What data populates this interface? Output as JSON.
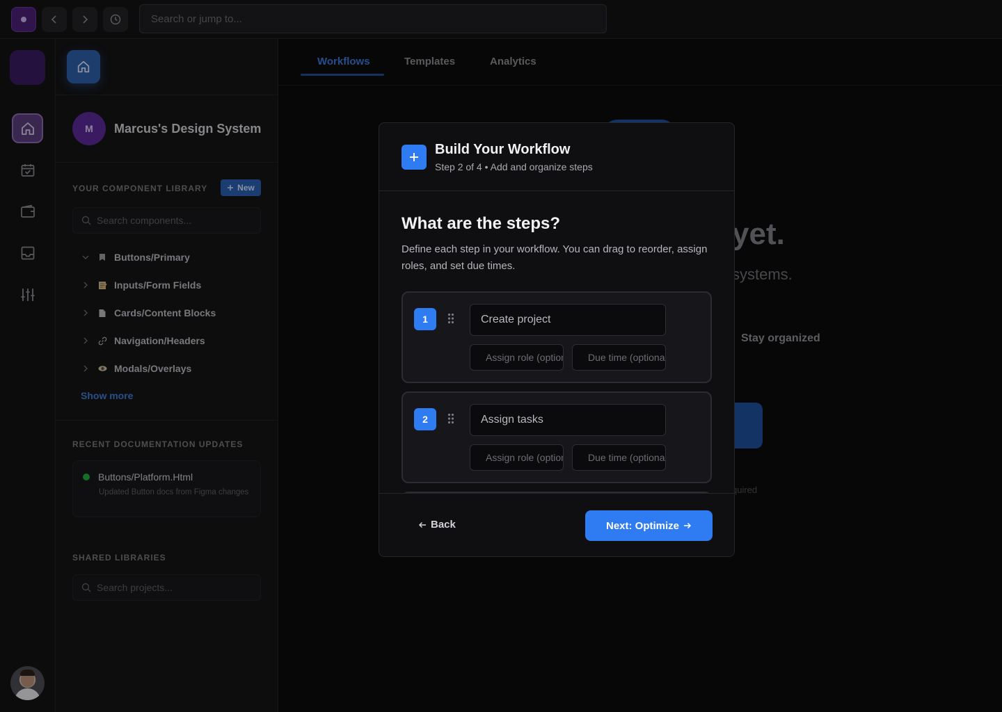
{
  "topbar": {
    "search_placeholder": "Search or jump to..."
  },
  "sidebar": {
    "workspace": {
      "initial": "M",
      "name": "Marcus's Design System"
    },
    "library": {
      "title": "YOUR COMPONENT LIBRARY",
      "new_label": "New",
      "search_placeholder": "Search components...",
      "items": [
        {
          "label": "Buttons/Primary",
          "icon": "bookmark-icon",
          "expanded": true
        },
        {
          "label": "Inputs/Form Fields",
          "icon": "memo-icon",
          "expanded": false
        },
        {
          "label": "Cards/Content Blocks",
          "icon": "document-icon",
          "expanded": false
        },
        {
          "label": "Navigation/Headers",
          "icon": "link-icon",
          "expanded": false
        },
        {
          "label": "Modals/Overlays",
          "icon": "eye-icon",
          "expanded": false
        }
      ],
      "show_more": "Show more"
    },
    "recent": {
      "title": "RECENT DOCUMENTATION UPDATES",
      "items": [
        {
          "title": "Buttons/Platform.Html",
          "desc": "Updated Button docs from Figma changes",
          "status_color": "#22a83a"
        }
      ]
    },
    "shared": {
      "title": "SHARED LIBRARIES",
      "search_placeholder": "Search projects..."
    }
  },
  "tabs": [
    {
      "label": "Workflows",
      "active": true
    },
    {
      "label": "Templates",
      "active": false
    },
    {
      "label": "Analytics",
      "active": false
    }
  ],
  "background": {
    "heading_fragment": "yet.",
    "sub_fragment": "systems.",
    "feature_label": "Stay organized",
    "footnote_fragment": "quired"
  },
  "modal": {
    "title": "Build Your Workflow",
    "subtitle": "Step 2 of 4 • Add and organize steps",
    "question": "What are the steps?",
    "description": "Define each step in your workflow. You can drag to reorder, assign roles, and set due times.",
    "steps": [
      {
        "number": "1",
        "name": "Create project",
        "role_placeholder": "Assign role (optional)",
        "time_placeholder": "Due time (optional)"
      },
      {
        "number": "2",
        "name": "Assign tasks",
        "role_placeholder": "Assign role (optional)",
        "time_placeholder": "Due time (optional)"
      }
    ],
    "back_label": "Back",
    "next_label": "Next: Optimize"
  },
  "colors": {
    "accent": "#2f7bf2",
    "brand_purple": "#4a1f75",
    "status_green": "#22a83a"
  }
}
